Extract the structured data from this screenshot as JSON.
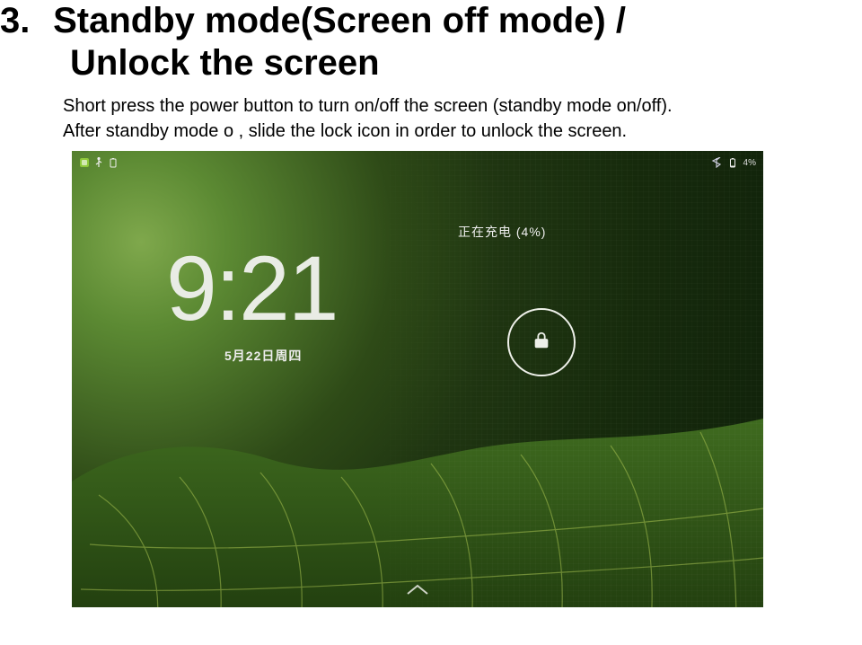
{
  "heading": {
    "number": "3.",
    "title_line1": "Standby mode(Screen off mode) /",
    "title_line2": "Unlock the screen"
  },
  "description": {
    "line1": "Short press the power button to turn on/off the screen (standby mode on/off).",
    "line2": "After standby mode o , slide the lock icon in order to unlock the screen."
  },
  "screenshot": {
    "status_bar": {
      "left_icons": [
        "app-icon",
        "usb-icon",
        "battery-small-icon"
      ],
      "right_battery_text": "4%",
      "right_icons": [
        "bluetooth-icon",
        "battery-icon"
      ]
    },
    "charging_text": "正在充电 (4%)",
    "clock": {
      "hour": "9",
      "sep": ":",
      "minute": "21"
    },
    "date": "5月22日周四",
    "lock_icon": "lock-icon",
    "chevron_icon": "chevron-up-icon"
  }
}
